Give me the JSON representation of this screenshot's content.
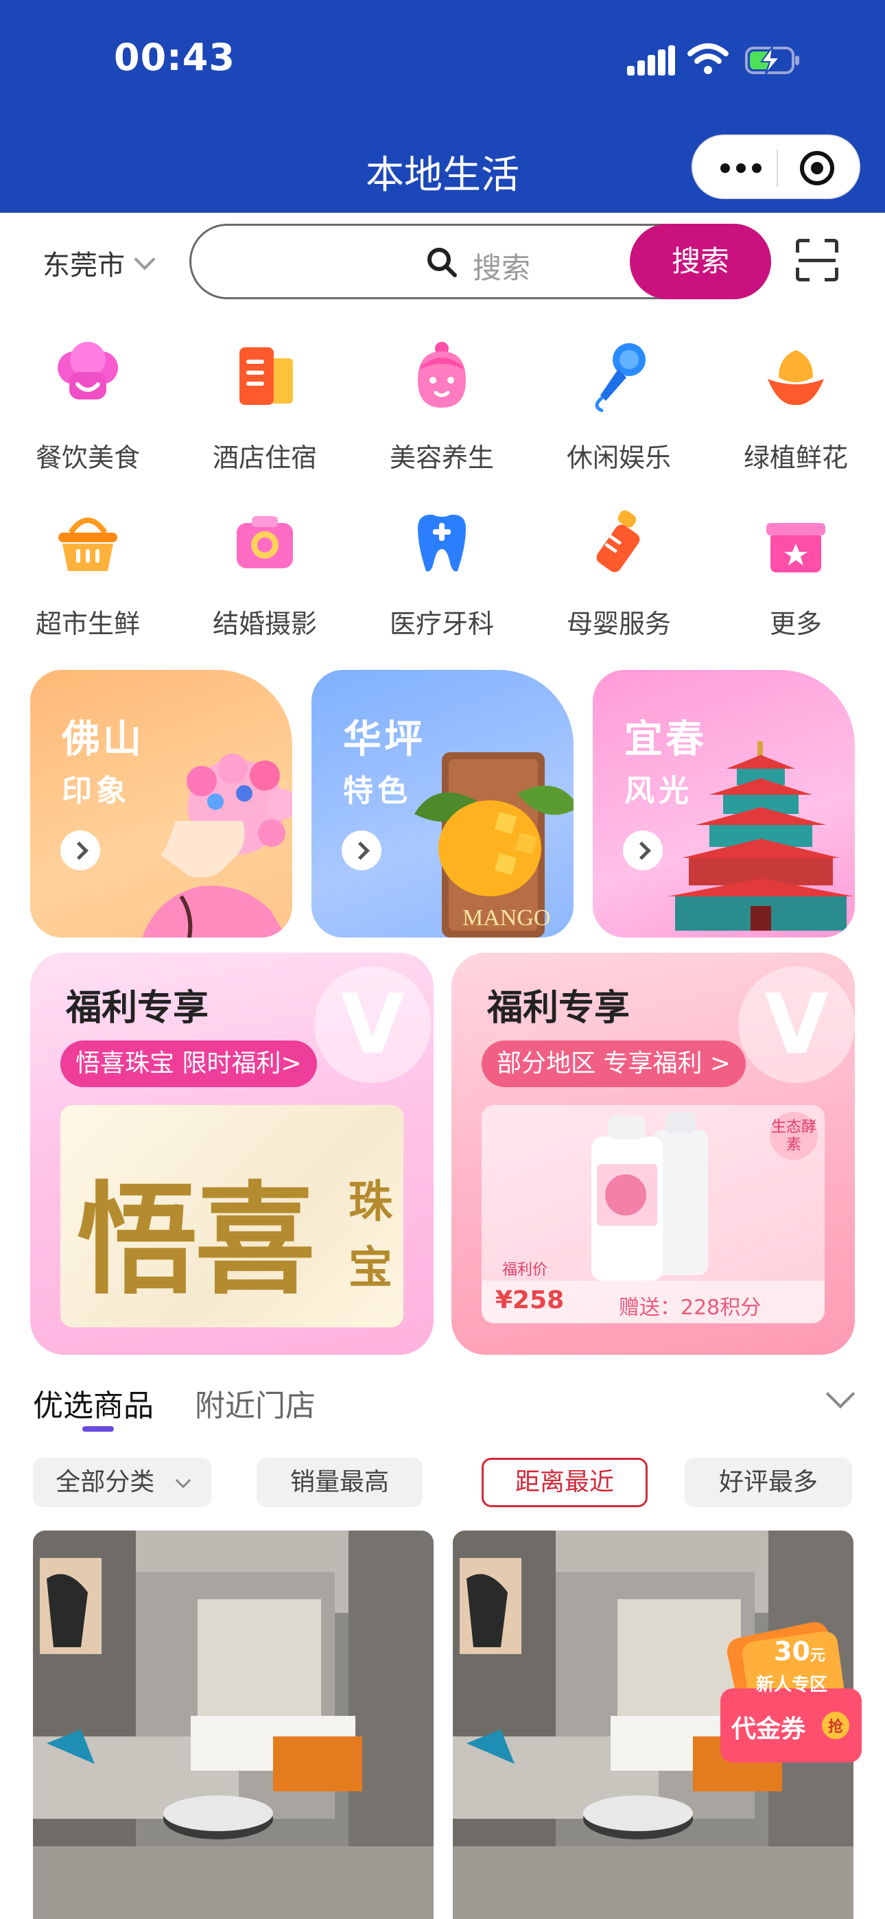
{
  "status_bar": {
    "time": "00:43"
  },
  "nav": {
    "title": "本地生活"
  },
  "search": {
    "city": "东莞市",
    "placeholder": "搜索",
    "button_label": "搜索"
  },
  "categories": [
    {
      "label": "餐饮美食",
      "icon": "chef-hat-icon"
    },
    {
      "label": "酒店住宿",
      "icon": "hotel-icon"
    },
    {
      "label": "美容养生",
      "icon": "face-mask-icon"
    },
    {
      "label": "休闲娱乐",
      "icon": "microphone-icon"
    },
    {
      "label": "绿植鲜花",
      "icon": "flower-icon"
    },
    {
      "label": "超市生鲜",
      "icon": "basket-icon"
    },
    {
      "label": "结婚摄影",
      "icon": "camera-icon"
    },
    {
      "label": "医疗牙科",
      "icon": "tooth-icon"
    },
    {
      "label": "母婴服务",
      "icon": "baby-bottle-icon"
    },
    {
      "label": "更多",
      "icon": "gift-box-icon"
    }
  ],
  "city_banners": [
    {
      "title": "佛山",
      "subtitle": "印象"
    },
    {
      "title": "华坪",
      "subtitle": "特色",
      "image_text": "MANGO"
    },
    {
      "title": "宜春",
      "subtitle": "风光"
    }
  ],
  "welfare": [
    {
      "title": "福利专享",
      "tag": "悟喜珠宝 限时福利>",
      "brand_big": "悟喜",
      "brand_side": [
        "珠",
        "宝"
      ],
      "badge": "V"
    },
    {
      "title": "福利专享",
      "tag": "部分地区 专享福利 >",
      "badge": "V",
      "eco_tag": "生态酵素",
      "price_label": "福利价",
      "price": "¥258",
      "gift": "赠送：228积分"
    }
  ],
  "tabs": {
    "items": [
      "优选商品",
      "附近门店"
    ],
    "active": 0
  },
  "filters": [
    {
      "label": "全部分类",
      "dropdown": true
    },
    {
      "label": "销量最高"
    },
    {
      "label": "距离最近",
      "active": true
    },
    {
      "label": "好评最多"
    }
  ],
  "coupon": {
    "amount": "30",
    "unit": "元",
    "subtitle": "新人专区",
    "label": "代金券",
    "badge": "抢"
  },
  "colors": {
    "brand_blue": "#1c47b9",
    "accent_magenta": "#c9127d",
    "active_red": "#d22a3a",
    "tab_indicator": "#6a4ae0"
  }
}
